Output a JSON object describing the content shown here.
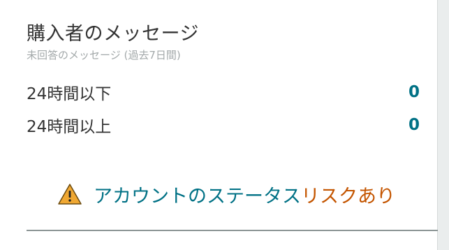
{
  "card": {
    "title": "購入者のメッセージ",
    "subtitle": "未回答のメッセージ (過去7日間)",
    "rows": [
      {
        "label": "24時間以下",
        "value": "0"
      },
      {
        "label": "24時間以上",
        "value": "0"
      }
    ]
  },
  "status": {
    "icon": "warning-icon",
    "link_text": "アカウントのステータス",
    "risk_text": "リスクあり"
  },
  "colors": {
    "link": "#007185",
    "risk": "#c45500",
    "warning_icon_fill": "#f0a833"
  }
}
